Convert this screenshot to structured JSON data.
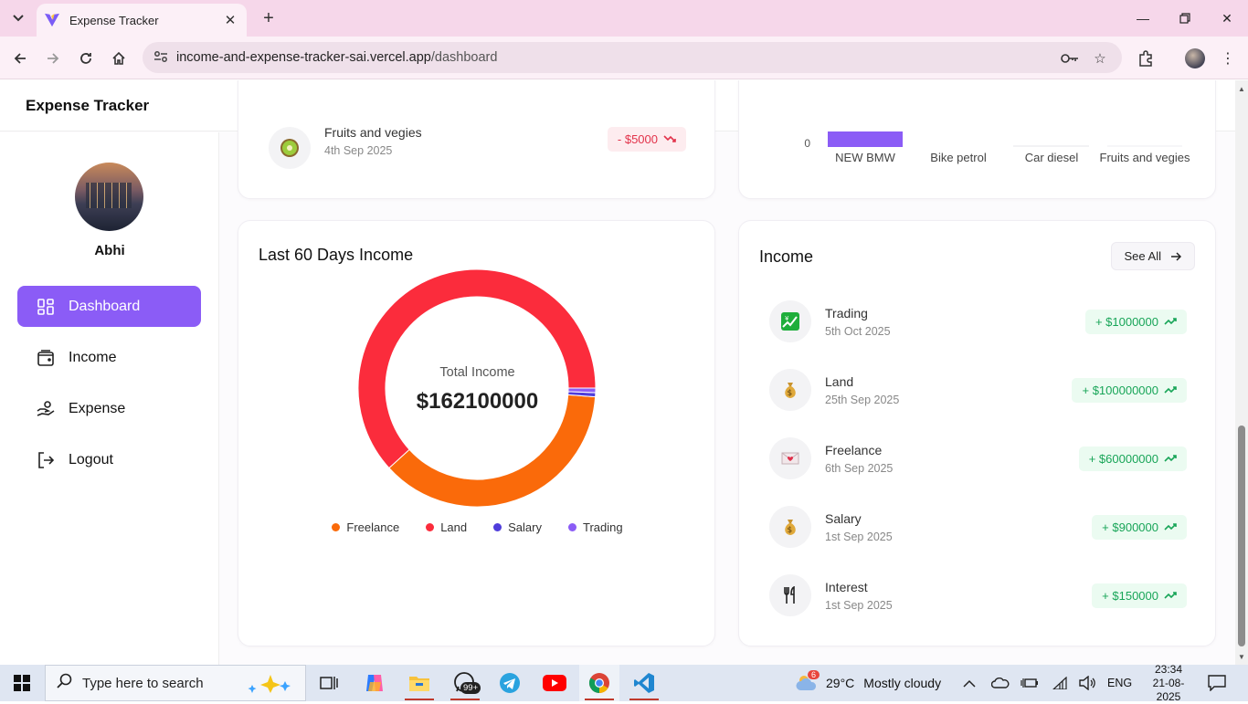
{
  "browser": {
    "tab_title": "Expense Tracker",
    "url_domain": "income-and-expense-tracker-sai.vercel.app",
    "url_path": "/dashboard"
  },
  "app": {
    "brand": "Expense Tracker",
    "username": "Abhi",
    "menu": [
      {
        "label": "Dashboard",
        "icon": "dashboard-icon",
        "active": true
      },
      {
        "label": "Income",
        "icon": "wallet-icon",
        "active": false
      },
      {
        "label": "Expense",
        "icon": "hand-coins-icon",
        "active": false
      },
      {
        "label": "Logout",
        "icon": "logout-icon",
        "active": false
      }
    ]
  },
  "expense_partial": {
    "title": "Fruits and vegies",
    "date": "4th Sep 2025",
    "amount": "- $5000",
    "icon": "kiwi-icon"
  },
  "bar_chart_partial": {
    "y_tick": "0",
    "categories": [
      "NEW BMW",
      "Bike petrol",
      "Car diesel",
      "Fruits and vegies"
    ],
    "bar_color": "#8b5cf6"
  },
  "income_donut": {
    "title": "Last 60 Days Income",
    "center_label": "Total Income",
    "center_value": "$162100000",
    "legend": [
      {
        "name": "Freelance",
        "color": "#fa6a0a"
      },
      {
        "name": "Land",
        "color": "#fb2c3c"
      },
      {
        "name": "Salary",
        "color": "#4f3ddb"
      },
      {
        "name": "Trading",
        "color": "#8b5cf6"
      }
    ]
  },
  "chart_data": {
    "type": "pie",
    "title": "Last 60 Days Income",
    "categories": [
      "Land",
      "Freelance",
      "Salary",
      "Trading"
    ],
    "values": [
      100000000,
      60000000,
      900000,
      1000000
    ],
    "colors": [
      "#fb2c3c",
      "#fa6a0a",
      "#4f3ddb",
      "#8b5cf6"
    ],
    "center_label": "Total Income",
    "center_value": "$162100000"
  },
  "income_list": {
    "title": "Income",
    "see_all": "See All",
    "items": [
      {
        "title": "Trading",
        "date": "5th Oct 2025",
        "amount": "+ $1000000",
        "icon": "chart-yen-icon"
      },
      {
        "title": "Land",
        "date": "25th Sep 2025",
        "amount": "+ $100000000",
        "icon": "money-bag-icon"
      },
      {
        "title": "Freelance",
        "date": "6th Sep 2025",
        "amount": "+ $60000000",
        "icon": "love-letter-icon"
      },
      {
        "title": "Salary",
        "date": "1st Sep 2025",
        "amount": "+ $900000",
        "icon": "money-bag-icon"
      },
      {
        "title": "Interest",
        "date": "1st Sep 2025",
        "amount": "+ $150000",
        "icon": "utensils-icon"
      }
    ]
  },
  "taskbar": {
    "search_placeholder": "Type here to search",
    "whatsapp_badge": "99+",
    "weather_badge": "6",
    "temperature": "29°C",
    "weather": "Mostly cloudy",
    "language": "ENG",
    "time": "23:34",
    "date": "21-08-2025"
  }
}
